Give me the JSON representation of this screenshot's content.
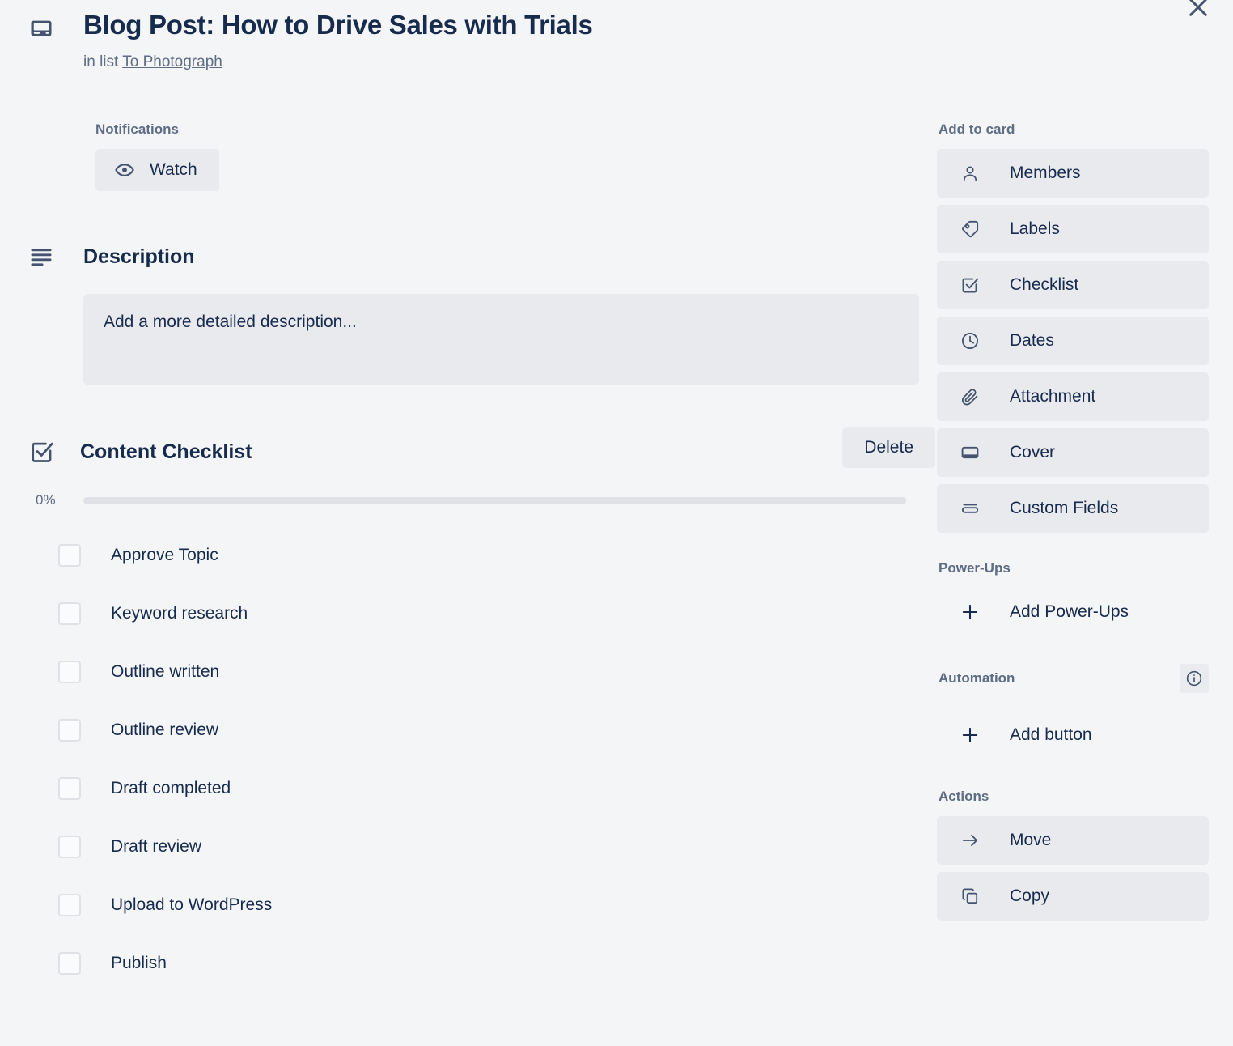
{
  "window": {
    "close_label": "✕",
    "close_icon": "close-icon"
  },
  "card": {
    "icon": "card-cover-icon",
    "title": "Blog Post: How to Drive Sales with Trials",
    "in_list_prefix": "in list",
    "list_name": "To Photograph"
  },
  "notifications": {
    "label": "Notifications",
    "watch_label": "Watch",
    "watch_icon": "eye-icon"
  },
  "description": {
    "icon": "description-lines-icon",
    "heading": "Description",
    "placeholder": "Add a more detailed description..."
  },
  "checklist": {
    "icon": "checklist-icon",
    "title": "Content Checklist",
    "delete_label": "Delete",
    "progress_percent_label": "0%",
    "progress_percent": 0,
    "items": [
      {
        "label": "Approve Topic",
        "checked": false
      },
      {
        "label": "Keyword research",
        "checked": false
      },
      {
        "label": "Outline written",
        "checked": false
      },
      {
        "label": "Outline review",
        "checked": false
      },
      {
        "label": "Draft completed",
        "checked": false
      },
      {
        "label": "Draft review",
        "checked": false
      },
      {
        "label": "Upload to WordPress",
        "checked": false
      },
      {
        "label": "Publish",
        "checked": false
      }
    ]
  },
  "sidebar": {
    "add_to_card": {
      "heading": "Add to card",
      "items": [
        {
          "label": "Members",
          "icon": "person-icon"
        },
        {
          "label": "Labels",
          "icon": "tag-icon"
        },
        {
          "label": "Checklist",
          "icon": "checklist-icon"
        },
        {
          "label": "Dates",
          "icon": "clock-icon"
        },
        {
          "label": "Attachment",
          "icon": "paperclip-icon"
        },
        {
          "label": "Cover",
          "icon": "cover-icon"
        },
        {
          "label": "Custom Fields",
          "icon": "custom-fields-icon"
        }
      ]
    },
    "power_ups": {
      "heading": "Power-Ups",
      "items": [
        {
          "label": "Add Power-Ups",
          "icon": "plus-icon"
        }
      ]
    },
    "automation": {
      "heading": "Automation",
      "info_icon": "info-icon",
      "items": [
        {
          "label": "Add button",
          "icon": "plus-icon"
        }
      ]
    },
    "actions": {
      "heading": "Actions",
      "items": [
        {
          "label": "Move",
          "icon": "arrow-right-icon"
        },
        {
          "label": "Copy",
          "icon": "copy-icon"
        }
      ]
    }
  },
  "colors": {
    "page_background": "#f4f5f7",
    "button_background": "#e9eaee",
    "text_primary": "#172b4d",
    "text_subtle": "#5e6c84",
    "icon": "#44546f",
    "progress_track": "#dfe1e6"
  }
}
